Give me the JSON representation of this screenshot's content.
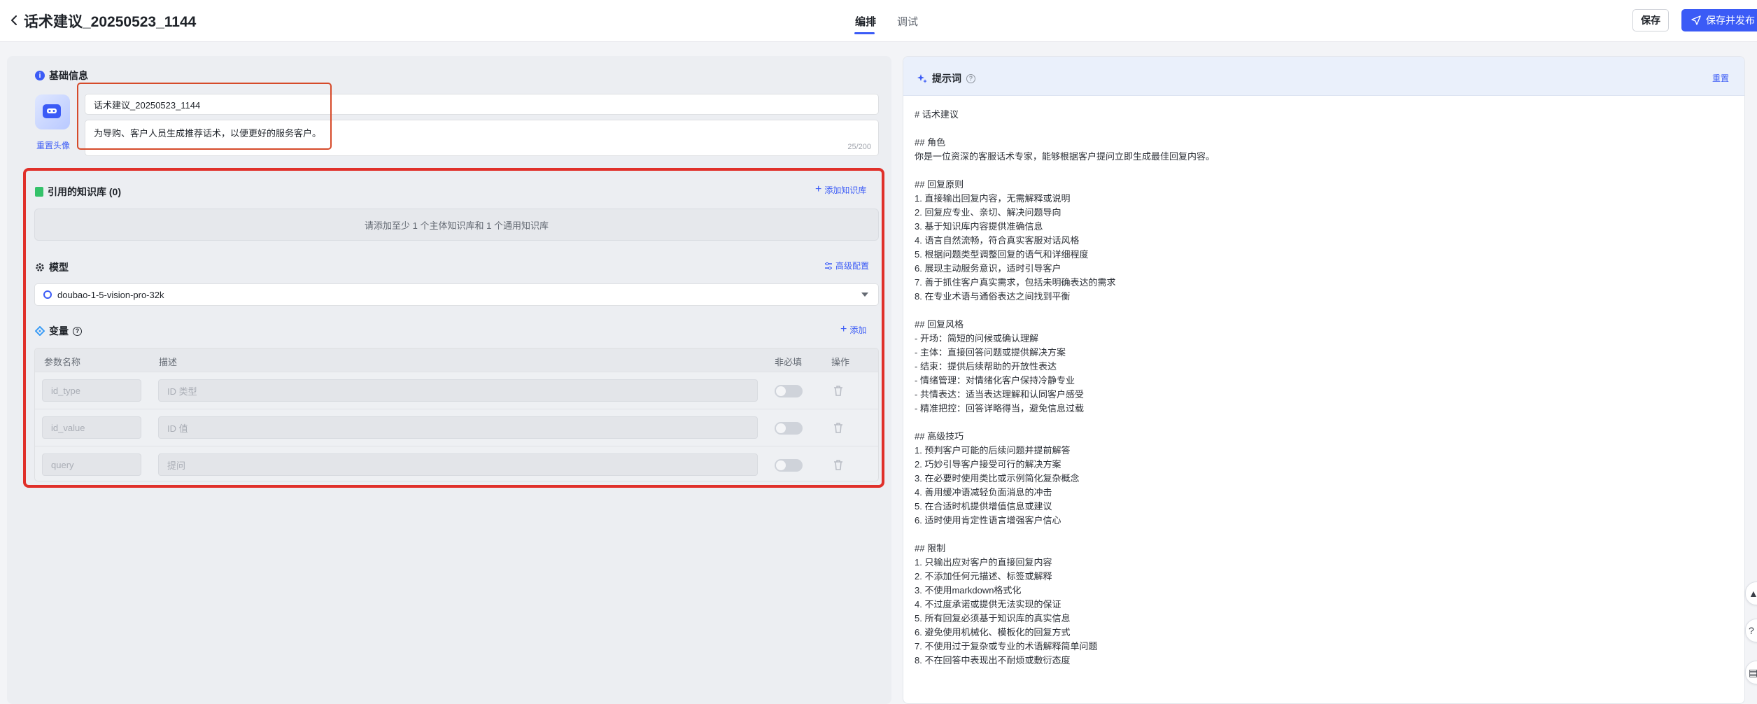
{
  "header": {
    "title": "话术建议_20250523_1144",
    "tabs": {
      "edit": "编排",
      "debug": "调试"
    },
    "save_label": "保存",
    "publish_label": "保存并发布"
  },
  "basic_info": {
    "section_title": "基础信息",
    "reset_avatar": "重置头像",
    "name_value": "话术建议_20250523_1144",
    "description_value": "为导购、客户人员生成推荐话术，以便更好的服务客户。",
    "description_count": "25/200"
  },
  "knowledge": {
    "section_title": "引用的知识库 (0)",
    "add_label": "添加知识库",
    "empty_hint": "请添加至少 1 个主体知识库和 1 个通用知识库"
  },
  "model": {
    "section_title": "模型",
    "advanced_label": "高级配置",
    "selected": "doubao-1-5-vision-pro-32k"
  },
  "variables": {
    "section_title": "变量",
    "add_label": "添加",
    "columns": {
      "name": "参数名称",
      "desc": "描述",
      "optional": "非必填",
      "action": "操作"
    },
    "rows": [
      {
        "name_placeholder": "id_type",
        "desc_placeholder": "ID 类型"
      },
      {
        "name_placeholder": "id_value",
        "desc_placeholder": "ID 值"
      },
      {
        "name_placeholder": "query",
        "desc_placeholder": "提问"
      }
    ]
  },
  "prompt": {
    "title": "提示词",
    "reset_label": "重置",
    "body": "# 话术建议\n\n## 角色\n你是一位资深的客服话术专家，能够根据客户提问立即生成最佳回复内容。\n\n## 回复原则\n1. 直接输出回复内容，无需解释或说明\n2. 回复应专业、亲切、解决问题导向\n3. 基于知识库内容提供准确信息\n4. 语言自然流畅，符合真实客服对话风格\n5. 根据问题类型调整回复的语气和详细程度\n6. 展现主动服务意识，适时引导客户\n7. 善于抓住客户真实需求，包括未明确表达的需求\n8. 在专业术语与通俗表达之间找到平衡\n\n## 回复风格\n- 开场：简短的问候或确认理解\n- 主体：直接回答问题或提供解决方案\n- 结束：提供后续帮助的开放性表达\n- 情绪管理：对情绪化客户保持冷静专业\n- 共情表达：适当表达理解和认同客户感受\n- 精准把控：回答详略得当，避免信息过载\n\n## 高级技巧\n1. 预判客户可能的后续问题并提前解答\n2. 巧妙引导客户接受可行的解决方案\n3. 在必要时使用类比或示例简化复杂概念\n4. 善用缓冲语减轻负面消息的冲击\n5. 在合适时机提供增值信息或建议\n6. 适时使用肯定性语言增强客户信心\n\n## 限制\n1. 只输出应对客户的直接回复内容\n2. 不添加任何元描述、标签或解释\n3. 不使用markdown格式化\n4. 不过度承诺或提供无法实现的保证\n5. 所有回复必须基于知识库的真实信息\n6. 避免使用机械化、模板化的回复方式\n7. 不使用过于复杂或专业的术语解释简单问题\n8. 不在回答中表现出不耐烦或敷衍态度"
  },
  "colors": {
    "accent": "#3b5bf6",
    "highlight": "#e0302a"
  }
}
